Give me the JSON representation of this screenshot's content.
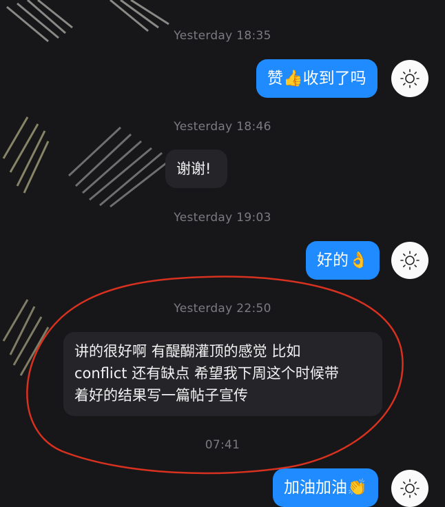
{
  "messages": [
    {
      "timestamp": "Yesterday 18:35",
      "direction": "outgoing",
      "text": "赞👍收到了吗"
    },
    {
      "timestamp": "Yesterday 18:46",
      "direction": "incoming",
      "text": "谢谢!"
    },
    {
      "timestamp": "Yesterday 19:03",
      "direction": "outgoing",
      "text": "好的👌"
    },
    {
      "timestamp": "Yesterday 22:50",
      "direction": "incoming",
      "lines": [
        "讲的很好啊 有醍醐灌顶的感觉 比如",
        "conflict 还有缺点 希望我下周这个时候带",
        "着好的结果写一篇帖子宣传"
      ]
    },
    {
      "timestamp": "07:41",
      "direction": "outgoing",
      "text": "加油加油👏"
    }
  ],
  "avatar_icon": "sun-icon",
  "colors": {
    "background": "#17171a",
    "outgoing_bubble": "#1f8bff",
    "incoming_bubble": "#252529",
    "annotation_circle": "#d8311f"
  }
}
